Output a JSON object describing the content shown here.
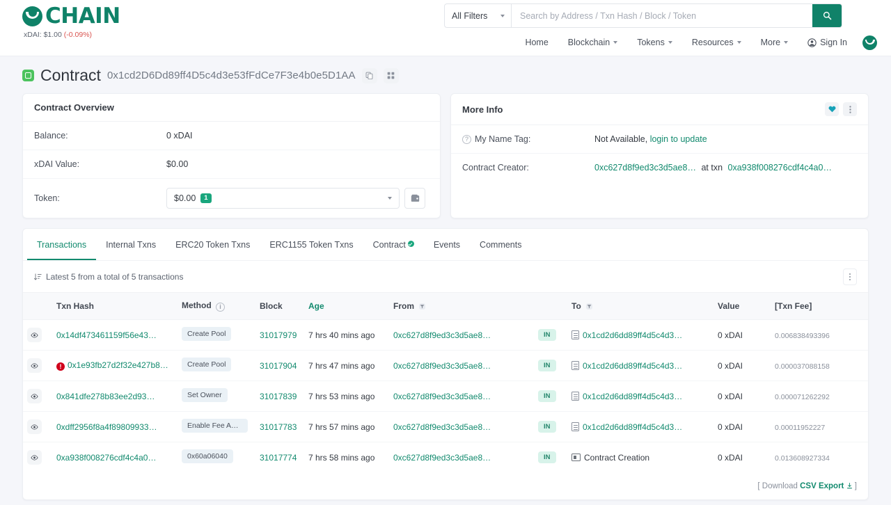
{
  "brand": {
    "name": "CHAIN",
    "logo_icon": "chain-logo-icon",
    "price_label": "xDAI: $1.00",
    "price_delta": "(-0.09%)"
  },
  "search": {
    "filter_label": "All Filters",
    "placeholder": "Search by Address / Txn Hash / Block / Token",
    "value": "",
    "button_icon": "search-icon"
  },
  "nav": {
    "items": [
      {
        "label": "Home",
        "caret": false
      },
      {
        "label": "Blockchain",
        "caret": true
      },
      {
        "label": "Tokens",
        "caret": true
      },
      {
        "label": "Resources",
        "caret": true
      },
      {
        "label": "More",
        "caret": true
      },
      {
        "label": "Sign In",
        "caret": false,
        "icon": "user-circle-icon"
      }
    ],
    "avatar_icon": "user-avatar-icon"
  },
  "page": {
    "type_label": "Contract",
    "address": "0x1cd2D6Dd89ff4D5c4d3e53fFdCe7F3e4b0e5D1AA",
    "copy_icon": "copy-icon",
    "qr_icon": "qr-code-icon"
  },
  "overview": {
    "title": "Contract Overview",
    "rows": [
      {
        "label": "Balance:",
        "value": "0 xDAI"
      },
      {
        "label": "xDAI Value:",
        "value": "$0.00"
      }
    ],
    "token": {
      "label": "Token:",
      "value": "$0.00",
      "count": "1",
      "chevron_icon": "chevron-down-icon",
      "wallet_icon": "wallet-icon"
    }
  },
  "more_info": {
    "title": "More Info",
    "heart_icon": "heart-icon",
    "kebab_icon": "kebab-menu-icon",
    "name_tag": {
      "label": "My Name Tag:",
      "help_icon": "question-circle-icon",
      "value": "Not Available,",
      "link": "login to update"
    },
    "creator": {
      "label": "Contract Creator:",
      "address": "0xc627d8f9ed3c3d5ae8…",
      "at_text": "at txn",
      "txn": "0xa938f008276cdf4c4a0…"
    }
  },
  "tabs": [
    {
      "label": "Transactions",
      "active": true,
      "verified": false
    },
    {
      "label": "Internal Txns",
      "active": false,
      "verified": false
    },
    {
      "label": "ERC20 Token Txns",
      "active": false,
      "verified": false
    },
    {
      "label": "ERC1155 Token Txns",
      "active": false,
      "verified": false
    },
    {
      "label": "Contract",
      "active": false,
      "verified": true
    },
    {
      "label": "Events",
      "active": false,
      "verified": false
    },
    {
      "label": "Comments",
      "active": false,
      "verified": false
    }
  ],
  "table": {
    "summary": "Latest 5 from a total of 5 transactions",
    "sort_icon": "sort-descending-icon",
    "options_icon": "kebab-menu-icon",
    "columns": [
      {
        "label": "Txn Hash",
        "green": false,
        "info": false,
        "filter": false
      },
      {
        "label": "Method",
        "green": false,
        "info": true,
        "filter": false
      },
      {
        "label": "Block",
        "green": false,
        "info": false,
        "filter": false
      },
      {
        "label": "Age",
        "green": true,
        "info": false,
        "filter": false
      },
      {
        "label": "From",
        "green": false,
        "info": false,
        "filter": true
      },
      {
        "label": "To",
        "green": false,
        "info": false,
        "filter": true
      },
      {
        "label": "Value",
        "green": false,
        "info": false,
        "filter": false
      },
      {
        "label": "[Txn Fee]",
        "green": false,
        "info": false,
        "filter": false
      }
    ],
    "rows": [
      {
        "eye_icon": "eye-icon",
        "error": false,
        "hash": "0x14df473461159f56e43…",
        "method": "Create Pool",
        "block": "31017979",
        "age": "7 hrs 40 mins ago",
        "from": "0xc627d8f9ed3c3d5ae8…",
        "direction": "IN",
        "to_icon": "contract-doc-icon",
        "to": "0x1cd2d6dd89ff4d5c4d3…",
        "to_is_link": true,
        "value": "0 xDAI",
        "fee": "0.006838493396"
      },
      {
        "eye_icon": "eye-icon",
        "error": true,
        "hash": "0x1e93fb27d2f32e427b8…",
        "method": "Create Pool",
        "block": "31017904",
        "age": "7 hrs 47 mins ago",
        "from": "0xc627d8f9ed3c3d5ae8…",
        "direction": "IN",
        "to_icon": "contract-doc-icon",
        "to": "0x1cd2d6dd89ff4d5c4d3…",
        "to_is_link": true,
        "value": "0 xDAI",
        "fee": "0.000037088158"
      },
      {
        "eye_icon": "eye-icon",
        "error": false,
        "hash": "0x841dfe278b83ee2d93…",
        "method": "Set Owner",
        "block": "31017839",
        "age": "7 hrs 53 mins ago",
        "from": "0xc627d8f9ed3c3d5ae8…",
        "direction": "IN",
        "to_icon": "contract-doc-icon",
        "to": "0x1cd2d6dd89ff4d5c4d3…",
        "to_is_link": true,
        "value": "0 xDAI",
        "fee": "0.000071262292"
      },
      {
        "eye_icon": "eye-icon",
        "error": false,
        "hash": "0xdff2956f8a4f89809933…",
        "method": "Enable Fee Amoun…",
        "block": "31017783",
        "age": "7 hrs 57 mins ago",
        "from": "0xc627d8f9ed3c3d5ae8…",
        "direction": "IN",
        "to_icon": "contract-doc-icon",
        "to": "0x1cd2d6dd89ff4d5c4d3…",
        "to_is_link": true,
        "value": "0 xDAI",
        "fee": "0.00011952227"
      },
      {
        "eye_icon": "eye-icon",
        "error": false,
        "hash": "0xa938f008276cdf4c4a0…",
        "method": "0x60a06040",
        "block": "31017774",
        "age": "7 hrs 58 mins ago",
        "from": "0xc627d8f9ed3c3d5ae8…",
        "direction": "IN",
        "to_icon": "contract-creation-icon",
        "to": "Contract Creation",
        "to_is_link": false,
        "value": "0 xDAI",
        "fee": "0.013608927334"
      }
    ],
    "footer": {
      "prefix": "[ Download",
      "link": "CSV Export",
      "download_icon": "download-icon",
      "suffix": "]"
    }
  },
  "colors": {
    "accent": "#128a6e",
    "brand": "#0f8268",
    "badge_green": "#19a67d",
    "error_red": "#d0021b",
    "in_badge_bg": "#d8f3ea"
  }
}
